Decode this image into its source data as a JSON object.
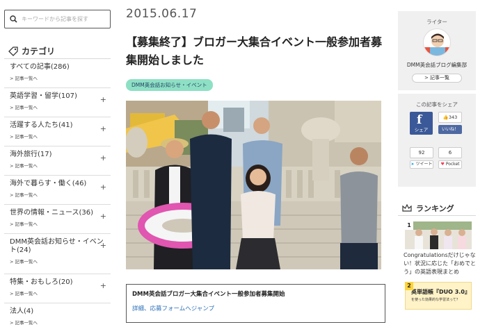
{
  "search": {
    "placeholder": "キーワードから記事を探す"
  },
  "categories": {
    "heading": "カテゴリ",
    "items": [
      {
        "label": "すべての記事(286)",
        "sub": "> 記事一覧へ",
        "plus": ""
      },
      {
        "label": "英語学習・留学(107)",
        "sub": "> 記事一覧へ",
        "plus": "+"
      },
      {
        "label": "活躍する人たち(41)",
        "sub": "> 記事一覧へ",
        "plus": "+"
      },
      {
        "label": "海外旅行(17)",
        "sub": "> 記事一覧へ",
        "plus": "+"
      },
      {
        "label": "海外で暮らす・働く(46)",
        "sub": "> 記事一覧へ",
        "plus": "+"
      },
      {
        "label": "世界の情報・ニュース(36)",
        "sub": "> 記事一覧へ",
        "plus": "+"
      },
      {
        "label": "DMM英会話お知らせ・イベント(24)",
        "sub": "> 記事一覧へ",
        "plus": "+"
      },
      {
        "label": "特集・おもしろ(20)",
        "sub": "> 記事一覧へ",
        "plus": "+"
      },
      {
        "label": "法人(4)",
        "sub": "> 記事一覧へ",
        "plus": ""
      }
    ]
  },
  "article": {
    "date": "2015.06.17",
    "title": "【募集終了】ブロガー大集合イベント一般参加者募集開始しました",
    "tag": "DMM英会話お知らせ・イベント",
    "toc_title": "DMM英会話ブロガー大集合イベント一般参加者募集開始",
    "toc_link": "詳細、応募フォームへジャンプ"
  },
  "writer": {
    "label": "ライター",
    "name": "DMM英会話ブログ編集部",
    "button": "> 記事一覧"
  },
  "share": {
    "label": "この記事をシェア",
    "facebook_label": "シェア",
    "like_count": "343",
    "like_label": "いいね！",
    "tweet_count": "92",
    "tweet_label": "ツイート",
    "pocket_count": "6",
    "pocket_label": "Pocket"
  },
  "ranking": {
    "heading": "ランキング",
    "items": [
      {
        "rank": "1",
        "text": "Congratulationsだけじゃない！状況に応じた「おめでとう」の英語表現まとめ"
      },
      {
        "rank": "2",
        "text": "英単語帳『DUO 3.0』を使った効果的な学習法って？",
        "thumb_title": "英単語帳『DUO 3.0』",
        "thumb_sub": "を使った効果的な学習法って？"
      }
    ]
  },
  "colors": {
    "tag_bg": "#8ee0c4",
    "facebook": "#3b5998",
    "link": "#2a6fb8"
  }
}
